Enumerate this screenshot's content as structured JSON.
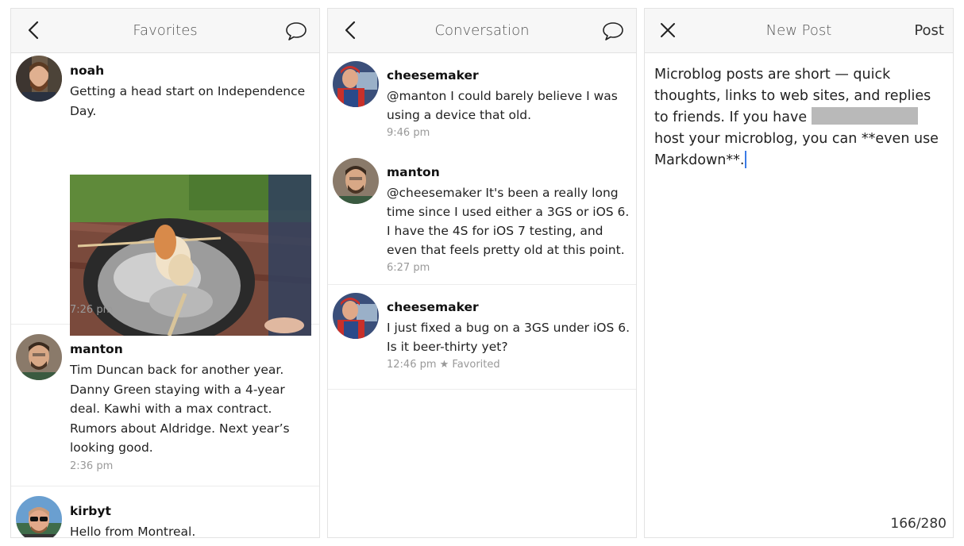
{
  "favorites": {
    "title": "Favorites",
    "posts": [
      {
        "username": "noah",
        "text": "Getting a head start on Independence Day.",
        "time": "7:26 pm"
      },
      {
        "username": "manton",
        "text": "Tim Duncan back for another year. Danny Green staying with a 4-year deal. Kawhi with a max contract. Rumors about Aldridge. Next year’s looking good.",
        "time": "2:36 pm"
      },
      {
        "username": "kirbyt",
        "text": "Hello from Montreal."
      }
    ]
  },
  "conversation": {
    "title": "Conversation",
    "posts": [
      {
        "username": "cheesemaker",
        "text": "@manton I could barely believe I was using a device that old.",
        "time": "9:46 pm"
      },
      {
        "username": "manton",
        "text": "@cheesemaker It's been a really long time since I used either a 3GS or iOS 6. I have the 4S for iOS 7 testing, and even that feels pretty old at this point.",
        "time": "6:27 pm"
      },
      {
        "username": "cheesemaker",
        "text": "I just fixed a bug on a 3GS under iOS 6. Is it beer-thirty yet?",
        "time": "12:46 pm ★ Favorited"
      }
    ]
  },
  "new_post": {
    "title": "New Post",
    "post_label": "Post",
    "text_part1": "Microblog posts are short — quick thoughts, links to web sites, and replies to friends. If you have",
    "text_part2": "host your microblog, you can **even use Markdown**.",
    "counter": "166/280"
  }
}
